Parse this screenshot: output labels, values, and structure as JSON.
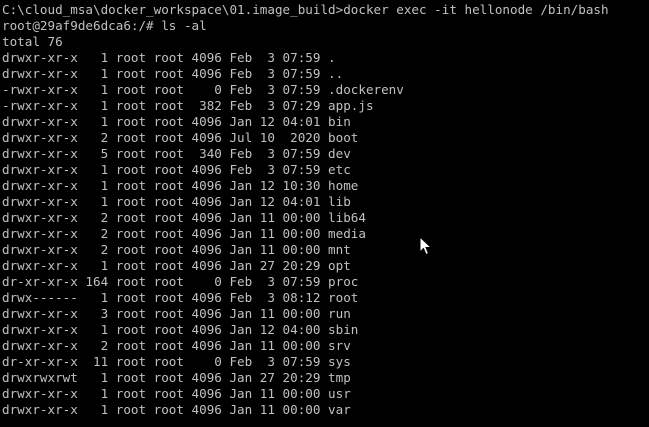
{
  "terminal": {
    "lines": [
      "C:\\cloud_msa\\docker_workspace\\01.image_build>docker exec -it hellonode /bin/bash",
      "root@29af9de6dca6:/# ls -al",
      "total 76",
      "drwxr-xr-x   1 root root 4096 Feb  3 07:59 .",
      "drwxr-xr-x   1 root root 4096 Feb  3 07:59 ..",
      "-rwxr-xr-x   1 root root    0 Feb  3 07:59 .dockerenv",
      "-rwxr-xr-x   1 root root  382 Feb  3 07:29 app.js",
      "drwxr-xr-x   1 root root 4096 Jan 12 04:01 bin",
      "drwxr-xr-x   2 root root 4096 Jul 10  2020 boot",
      "drwxr-xr-x   5 root root  340 Feb  3 07:59 dev",
      "drwxr-xr-x   1 root root 4096 Feb  3 07:59 etc",
      "drwxr-xr-x   1 root root 4096 Jan 12 10:30 home",
      "drwxr-xr-x   1 root root 4096 Jan 12 04:01 lib",
      "drwxr-xr-x   2 root root 4096 Jan 11 00:00 lib64",
      "drwxr-xr-x   2 root root 4096 Jan 11 00:00 media",
      "drwxr-xr-x   2 root root 4096 Jan 11 00:00 mnt",
      "drwxr-xr-x   1 root root 4096 Jan 27 20:29 opt",
      "dr-xr-xr-x 164 root root    0 Feb  3 07:59 proc",
      "drwx------   1 root root 4096 Feb  3 08:12 root",
      "drwxr-xr-x   3 root root 4096 Jan 11 00:00 run",
      "drwxr-xr-x   1 root root 4096 Jan 12 04:00 sbin",
      "drwxr-xr-x   2 root root 4096 Jan 11 00:00 srv",
      "dr-xr-xr-x  11 root root    0 Feb  3 07:59 sys",
      "drwxrwxrwt   1 root root 4096 Jan 27 20:29 tmp",
      "drwxr-xr-x   1 root root 4096 Jan 11 00:00 usr",
      "drwxr-xr-x   1 root root 4096 Jan 11 00:00 var"
    ]
  },
  "colors": {
    "background": "#000000",
    "text": "#c0c0c0",
    "pointer_fill": "#ffffff",
    "pointer_stroke": "#000000"
  },
  "pointer": {
    "icon": "mouse-pointer-icon"
  }
}
